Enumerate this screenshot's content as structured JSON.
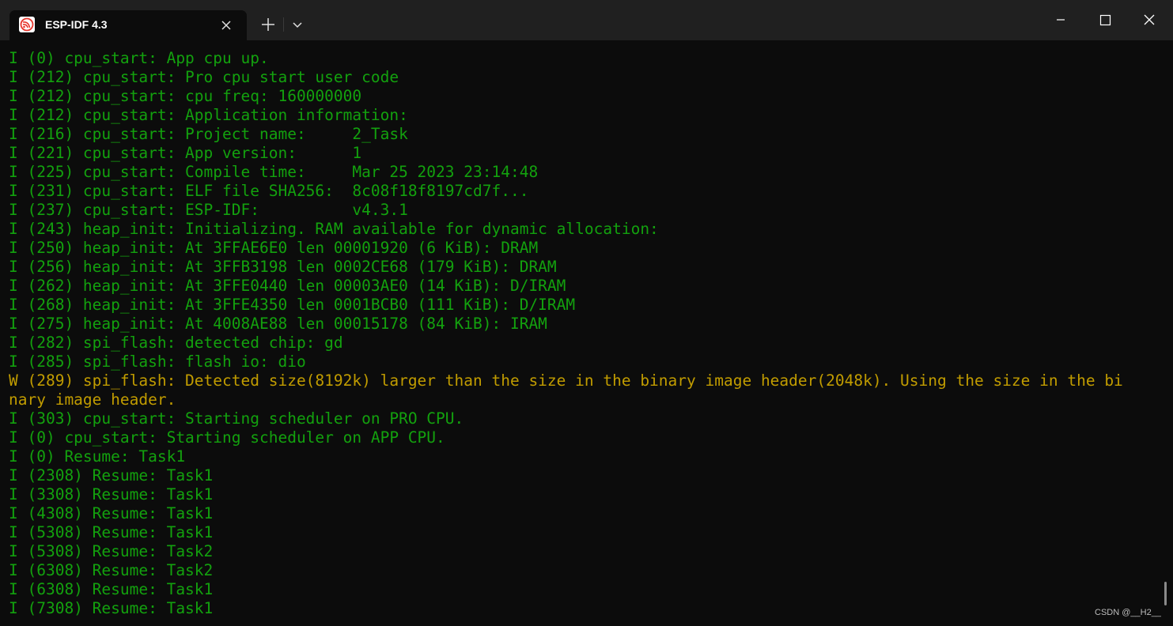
{
  "tab": {
    "title": "ESP-IDF 4.3",
    "icon": "espressif-logo-icon"
  },
  "titlebar_buttons": {
    "new_tab": "plus-icon",
    "dropdown": "chevron-down-icon",
    "minimize": "minimize-icon",
    "maximize": "maximize-icon",
    "close": "close-icon"
  },
  "colors": {
    "info": "#13a10e",
    "warning": "#c19c00",
    "background": "#0c0c0c",
    "titlebar": "#202020"
  },
  "terminal": {
    "lines": [
      {
        "level": "info",
        "text": "I (0) cpu_start: App cpu up."
      },
      {
        "level": "info",
        "text": "I (212) cpu_start: Pro cpu start user code"
      },
      {
        "level": "info",
        "text": "I (212) cpu_start: cpu freq: 160000000"
      },
      {
        "level": "info",
        "text": "I (212) cpu_start: Application information:"
      },
      {
        "level": "info",
        "text": "I (216) cpu_start: Project name:     2_Task"
      },
      {
        "level": "info",
        "text": "I (221) cpu_start: App version:      1"
      },
      {
        "level": "info",
        "text": "I (225) cpu_start: Compile time:     Mar 25 2023 23:14:48"
      },
      {
        "level": "info",
        "text": "I (231) cpu_start: ELF file SHA256:  8c08f18f8197cd7f..."
      },
      {
        "level": "info",
        "text": "I (237) cpu_start: ESP-IDF:          v4.3.1"
      },
      {
        "level": "info",
        "text": "I (243) heap_init: Initializing. RAM available for dynamic allocation:"
      },
      {
        "level": "info",
        "text": "I (250) heap_init: At 3FFAE6E0 len 00001920 (6 KiB): DRAM"
      },
      {
        "level": "info",
        "text": "I (256) heap_init: At 3FFB3198 len 0002CE68 (179 KiB): DRAM"
      },
      {
        "level": "info",
        "text": "I (262) heap_init: At 3FFE0440 len 00003AE0 (14 KiB): D/IRAM"
      },
      {
        "level": "info",
        "text": "I (268) heap_init: At 3FFE4350 len 0001BCB0 (111 KiB): D/IRAM"
      },
      {
        "level": "info",
        "text": "I (275) heap_init: At 4008AE88 len 00015178 (84 KiB): IRAM"
      },
      {
        "level": "info",
        "text": "I (282) spi_flash: detected chip: gd"
      },
      {
        "level": "info",
        "text": "I (285) spi_flash: flash io: dio"
      },
      {
        "level": "warn",
        "text": "W (289) spi_flash: Detected size(8192k) larger than the size in the binary image header(2048k). Using the size in the bi"
      },
      {
        "level": "warn",
        "text": "nary image header."
      },
      {
        "level": "info",
        "text": "I (303) cpu_start: Starting scheduler on PRO CPU."
      },
      {
        "level": "info",
        "text": "I (0) cpu_start: Starting scheduler on APP CPU."
      },
      {
        "level": "info",
        "text": "I (0) Resume: Task1"
      },
      {
        "level": "info",
        "text": "I (2308) Resume: Task1"
      },
      {
        "level": "info",
        "text": "I (3308) Resume: Task1"
      },
      {
        "level": "info",
        "text": "I (4308) Resume: Task1"
      },
      {
        "level": "info",
        "text": "I (5308) Resume: Task1"
      },
      {
        "level": "info",
        "text": "I (5308) Resume: Task2"
      },
      {
        "level": "info",
        "text": "I (6308) Resume: Task2"
      },
      {
        "level": "info",
        "text": "I (6308) Resume: Task1"
      },
      {
        "level": "info",
        "text": "I (7308) Resume: Task1"
      }
    ]
  },
  "watermark": "CSDN @__H2__"
}
